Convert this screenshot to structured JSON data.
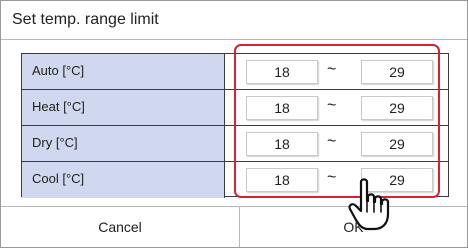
{
  "dialog": {
    "title": "Set temp. range limit",
    "separator": "~",
    "rows": [
      {
        "label": "Auto [°C]",
        "min": "18",
        "max": "29"
      },
      {
        "label": "Heat [°C]",
        "min": "18",
        "max": "29"
      },
      {
        "label": "Dry [°C]",
        "min": "18",
        "max": "29"
      },
      {
        "label": "Cool [°C]",
        "min": "18",
        "max": "29"
      }
    ],
    "cancel_label": "Cancel",
    "ok_label": "OK"
  },
  "colors": {
    "label_bg": "#cfd8ee",
    "highlight": "#d32433"
  },
  "icons": {
    "pointer": "hand-pointer-icon"
  }
}
